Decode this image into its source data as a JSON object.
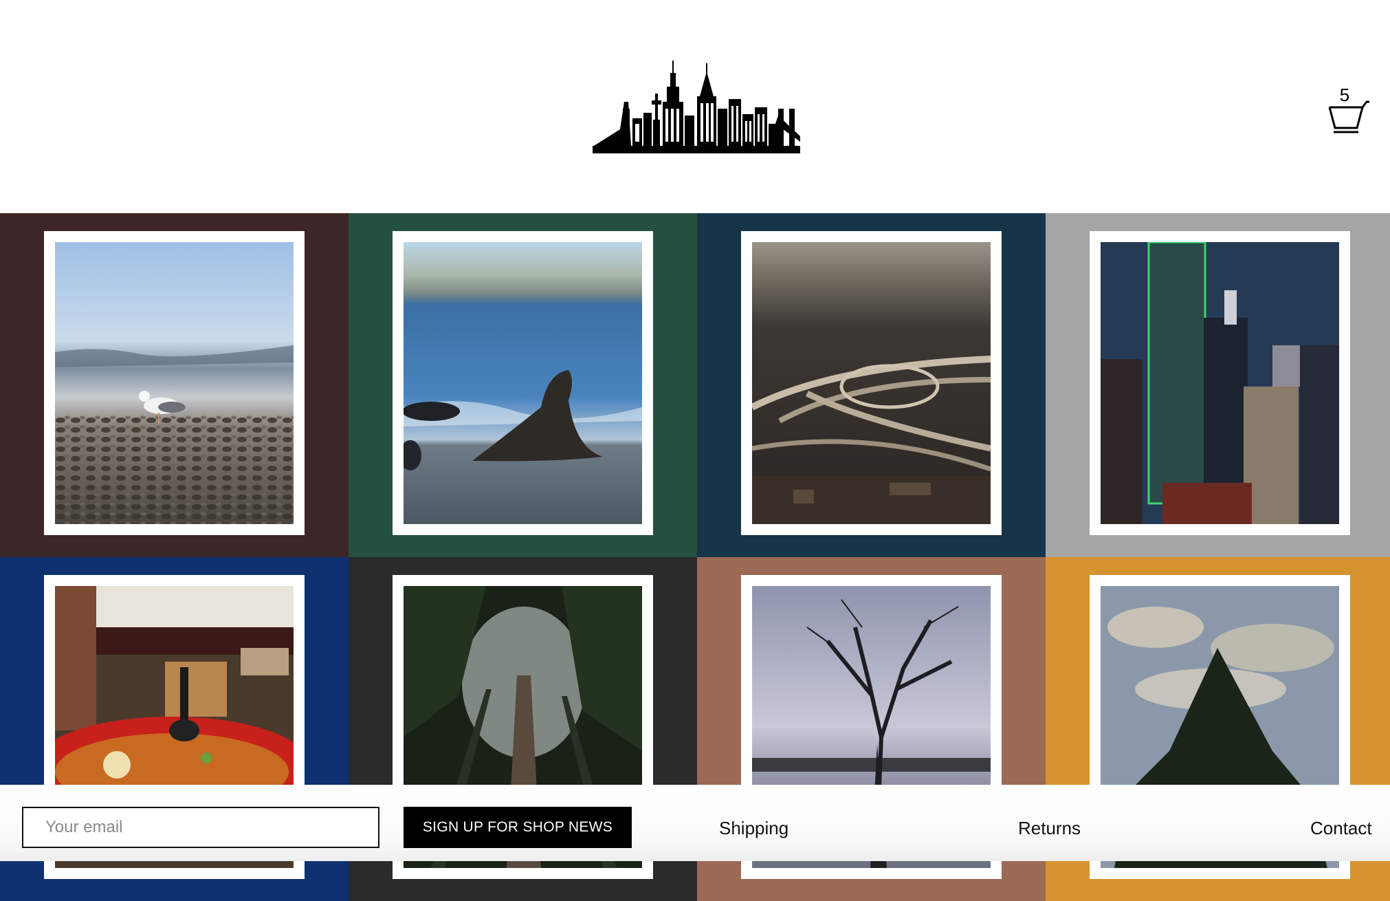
{
  "header": {
    "logo_name": "city-skyline-logo",
    "cart": {
      "count": "5",
      "icon": "basket-icon"
    }
  },
  "gallery": {
    "tiles": [
      {
        "name": "seagull-on-beach",
        "bg": "#3d2628"
      },
      {
        "name": "sea-lion-on-shore",
        "bg": "#24503f"
      },
      {
        "name": "highway-interchange",
        "bg": "#173449"
      },
      {
        "name": "city-skyscrapers",
        "bg": "#a5a5a5"
      },
      {
        "name": "ramen-bowl",
        "bg": "#0f316f"
      },
      {
        "name": "forest-canopy",
        "bg": "#2b2b2b"
      },
      {
        "name": "bare-tree-by-water",
        "bg": "#9a6a55"
      },
      {
        "name": "evergreen-tree-sky",
        "bg": "#d6922f"
      }
    ]
  },
  "footer": {
    "email_placeholder": "Your email",
    "signup_label": "SIGN UP FOR SHOP NEWS",
    "links": {
      "shipping": "Shipping",
      "returns": "Returns",
      "contact": "Contact"
    }
  }
}
